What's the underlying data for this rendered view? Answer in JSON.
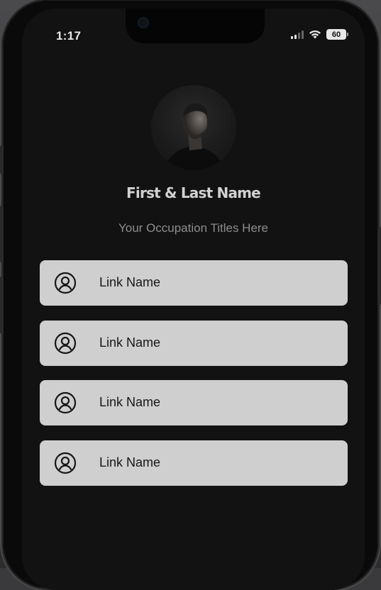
{
  "status_bar": {
    "time": "1:17",
    "battery": "60"
  },
  "profile": {
    "name": "First & Last Name",
    "title": "Your Occupation Titles Here"
  },
  "links": [
    {
      "label": "Link Name",
      "icon": "user-circle-icon"
    },
    {
      "label": "Link Name",
      "icon": "user-circle-icon"
    },
    {
      "label": "Link Name",
      "icon": "user-circle-icon"
    },
    {
      "label": "Link Name",
      "icon": "user-circle-icon"
    }
  ],
  "colors": {
    "screen_background": "#121212",
    "card_background": "#cfcfcf",
    "name_text": "#d2d2d2",
    "title_text": "#8e8e8e"
  }
}
